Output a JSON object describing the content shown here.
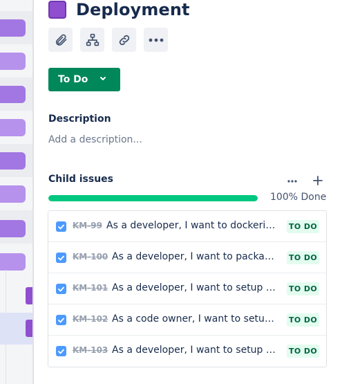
{
  "issue": {
    "title": "Deployment",
    "epic_color": "#8f4fcf"
  },
  "toolbar": {
    "attach_icon": "paperclip-icon",
    "hierarchy_icon": "child-issue-icon",
    "link_icon": "link-icon",
    "more_icon": "more-icon"
  },
  "status": {
    "label": "To Do",
    "color": "#00875a"
  },
  "description": {
    "label": "Description",
    "placeholder": "Add a description..."
  },
  "child_issues": {
    "label": "Child issues",
    "progress_percent": 100,
    "progress_text": "100% Done",
    "items": [
      {
        "key": "KM-99",
        "summary": "As a developer, I want to dockerise the application",
        "status": "TO DO",
        "checked": true
      },
      {
        "key": "KM-100",
        "summary": "As a developer, I want to package the application",
        "status": "TO DO",
        "checked": true
      },
      {
        "key": "KM-101",
        "summary": "As a developer, I want to setup the pipeline",
        "status": "TO DO",
        "checked": true
      },
      {
        "key": "KM-102",
        "summary": "As a code owner, I want to setup code reviews",
        "status": "TO DO",
        "checked": true
      },
      {
        "key": "KM-103",
        "summary": "As a developer, I want to setup an environment",
        "status": "TO DO",
        "checked": true
      }
    ]
  }
}
